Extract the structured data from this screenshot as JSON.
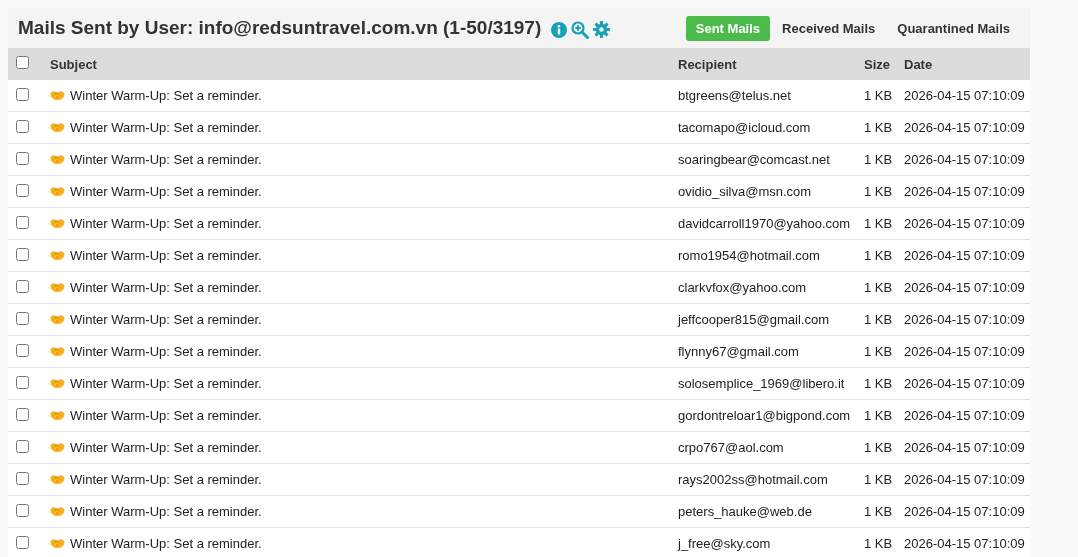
{
  "header": {
    "title": "Mails Sent by User: info@redsuntravel.com.vn (1-50/3197)"
  },
  "tabs": [
    {
      "label": "Sent Mails",
      "selected": true
    },
    {
      "label": "Received Mails",
      "selected": false
    },
    {
      "label": "Quarantined Mails",
      "selected": false
    }
  ],
  "table": {
    "select_all": {
      "checked": false
    },
    "columns": [
      "Subject",
      "Recipient",
      "Size",
      "Date"
    ],
    "rows": [
      {
        "checked": false,
        "subject": "Winter Warm-Up: Set a reminder.",
        "recipient": "btgreens@telus.net",
        "size": "1 KB",
        "date": "2026-04-15 07:10:09"
      },
      {
        "checked": false,
        "subject": "Winter Warm-Up: Set a reminder.",
        "recipient": "tacomapo@icloud.com",
        "size": "1 KB",
        "date": "2026-04-15 07:10:09"
      },
      {
        "checked": false,
        "subject": "Winter Warm-Up: Set a reminder.",
        "recipient": "soaringbear@comcast.net",
        "size": "1 KB",
        "date": "2026-04-15 07:10:09"
      },
      {
        "checked": false,
        "subject": "Winter Warm-Up: Set a reminder.",
        "recipient": "ovidio_silva@msn.com",
        "size": "1 KB",
        "date": "2026-04-15 07:10:09"
      },
      {
        "checked": false,
        "subject": "Winter Warm-Up: Set a reminder.",
        "recipient": "davidcarroll1970@yahoo.com",
        "size": "1 KB",
        "date": "2026-04-15 07:10:09"
      },
      {
        "checked": false,
        "subject": "Winter Warm-Up: Set a reminder.",
        "recipient": "romo1954@hotmail.com",
        "size": "1 KB",
        "date": "2026-04-15 07:10:09"
      },
      {
        "checked": false,
        "subject": "Winter Warm-Up: Set a reminder.",
        "recipient": "clarkvfox@yahoo.com",
        "size": "1 KB",
        "date": "2026-04-15 07:10:09"
      },
      {
        "checked": false,
        "subject": "Winter Warm-Up: Set a reminder.",
        "recipient": "jeffcooper815@gmail.com",
        "size": "1 KB",
        "date": "2026-04-15 07:10:09"
      },
      {
        "checked": false,
        "subject": "Winter Warm-Up: Set a reminder.",
        "recipient": "flynny67@gmail.com",
        "size": "1 KB",
        "date": "2026-04-15 07:10:09"
      },
      {
        "checked": false,
        "subject": "Winter Warm-Up: Set a reminder.",
        "recipient": "solosemplice_1969@libero.it",
        "size": "1 KB",
        "date": "2026-04-15 07:10:09"
      },
      {
        "checked": false,
        "subject": "Winter Warm-Up: Set a reminder.",
        "recipient": "gordontreloar1@bigpond.com",
        "size": "1 KB",
        "date": "2026-04-15 07:10:09"
      },
      {
        "checked": false,
        "subject": "Winter Warm-Up: Set a reminder.",
        "recipient": "crpo767@aol.com",
        "size": "1 KB",
        "date": "2026-04-15 07:10:09"
      },
      {
        "checked": false,
        "subject": "Winter Warm-Up: Set a reminder.",
        "recipient": "rays2002ss@hotmail.com",
        "size": "1 KB",
        "date": "2026-04-15 07:10:09"
      },
      {
        "checked": false,
        "subject": "Winter Warm-Up: Set a reminder.",
        "recipient": "peters_hauke@web.de",
        "size": "1 KB",
        "date": "2026-04-15 07:10:09"
      },
      {
        "checked": false,
        "subject": "Winter Warm-Up: Set a reminder.",
        "recipient": "j_free@sky.com",
        "size": "1 KB",
        "date": "2026-04-15 07:10:09"
      }
    ]
  }
}
